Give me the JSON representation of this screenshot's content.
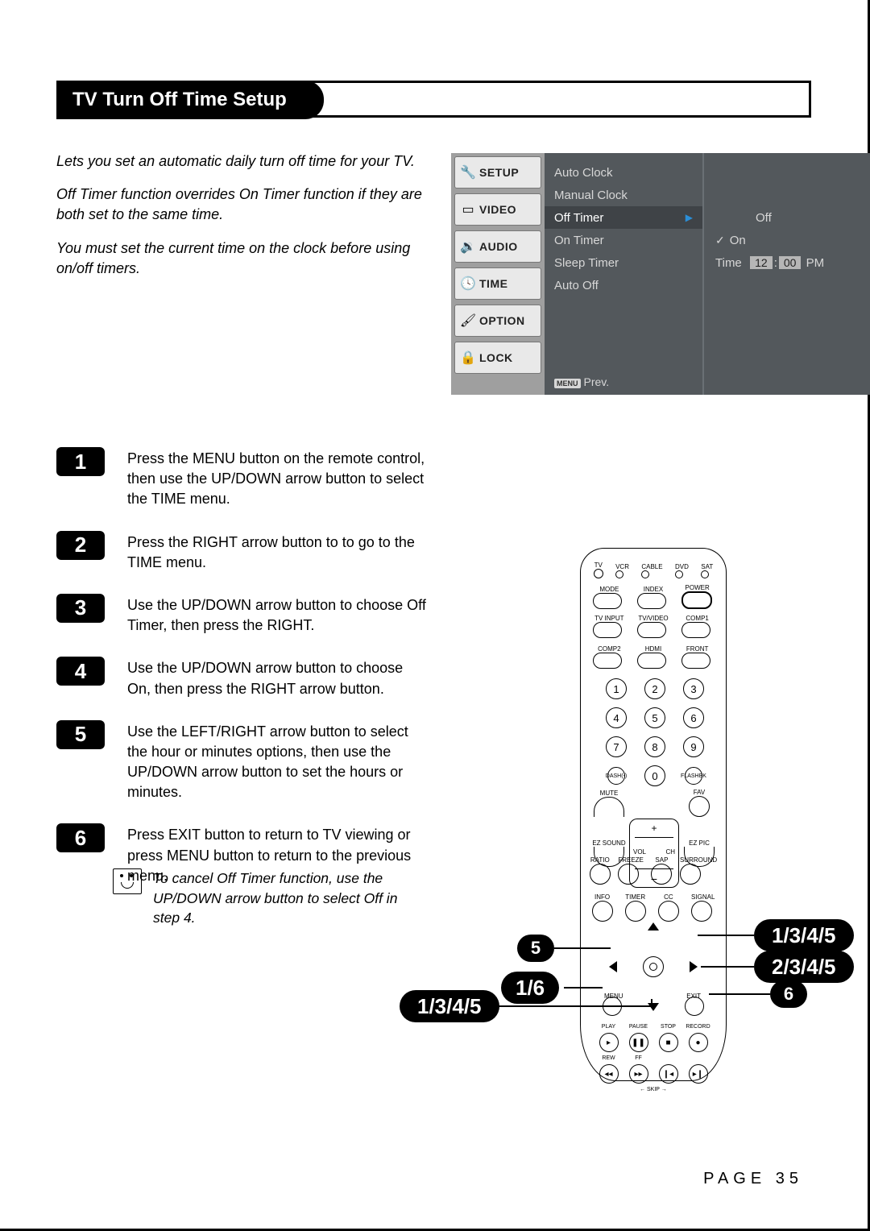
{
  "title": "TV Turn Off Time Setup",
  "intro": {
    "p1": "Lets you set an automatic daily turn off time for your TV.",
    "p2": "Off Timer function overrides On Timer function if they are both set to the same time.",
    "p3": "You must set the current time on the clock before using on/off timers."
  },
  "osd": {
    "tabs": {
      "setup": "SETUP",
      "video": "VIDEO",
      "audio": "AUDIO",
      "time": "TIME",
      "option": "OPTION",
      "lock": "LOCK"
    },
    "items": {
      "auto_clock": "Auto Clock",
      "manual_clock": "Manual Clock",
      "off_timer": "Off Timer",
      "on_timer": "On Timer",
      "sleep_timer": "Sleep Timer",
      "auto_off": "Auto Off"
    },
    "prev_badge": "MENU",
    "prev": "Prev.",
    "right": {
      "off": "Off",
      "on": "On",
      "time_label": "Time",
      "hour": "12",
      "colon": ":",
      "minute": "00",
      "ampm": "PM"
    }
  },
  "steps": {
    "s1": "Press the MENU button on the remote control, then use the UP/DOWN arrow button to select the TIME menu.",
    "s2": "Press the RIGHT arrow button to to go to the TIME menu.",
    "s3": "Use the UP/DOWN arrow button to choose Off Timer, then press the RIGHT.",
    "s4": "Use the UP/DOWN arrow button to choose On, then press the RIGHT arrow button.",
    "s5": "Use the LEFT/RIGHT arrow button to select the hour or minutes options, then use the UP/DOWN arrow button to set the hours or minutes.",
    "s6": "Press EXIT button to return to TV viewing or press MENU button to return to the previous menu."
  },
  "step_nums": {
    "n1": "1",
    "n2": "2",
    "n3": "3",
    "n4": "4",
    "n5": "5",
    "n6": "6"
  },
  "tip": "To cancel Off Timer function, use the UP/DOWN arrow button to select Off in step 4.",
  "remote": {
    "leds": {
      "tv": "TV",
      "vcr": "VCR",
      "cable": "CABLE",
      "dvd": "DVD",
      "sat": "SAT"
    },
    "row1": {
      "mode": "MODE",
      "index": "INDEX",
      "power": "POWER"
    },
    "row2": {
      "tvinput": "TV INPUT",
      "tvvideo": "TV/VIDEO",
      "comp1": "COMP1"
    },
    "row3": {
      "comp2": "COMP2",
      "hdmi": "HDMI",
      "front": "FRONT"
    },
    "numpad": {
      "1": "1",
      "2": "2",
      "3": "3",
      "4": "4",
      "5": "5",
      "6": "6",
      "7": "7",
      "8": "8",
      "9": "9",
      "dash": "DASH(-)",
      "0": "0",
      "flash": "FLASHBK"
    },
    "mid": {
      "mute": "MUTE",
      "fav": "FAV",
      "ezsound": "EZ SOUND",
      "ezpic": "EZ PIC",
      "vol": "VOL",
      "ch": "CH"
    },
    "ratio": {
      "ratio": "RATIO",
      "freeze": "FREEZE",
      "sap": "SAP",
      "surround": "SURROUND"
    },
    "info": {
      "info": "INFO",
      "timer": "TIMER",
      "cc": "CC",
      "signal": "SIGNAL"
    },
    "dpad": {
      "menu": "MENU",
      "exit": "EXIT"
    },
    "transport": {
      "play": "PLAY",
      "pause": "PAUSE",
      "stop": "STOP",
      "record": "RECORD",
      "rew": "REW",
      "ff": "FF",
      "skip": "SKIP"
    }
  },
  "callouts": {
    "c_up": "1/3/4/5",
    "c_right": "2/3/4/5",
    "c_exit": "6",
    "c_left": "5",
    "c_menu": "1/6",
    "c_down": "1/3/4/5"
  },
  "page_label": "PAGE 35"
}
